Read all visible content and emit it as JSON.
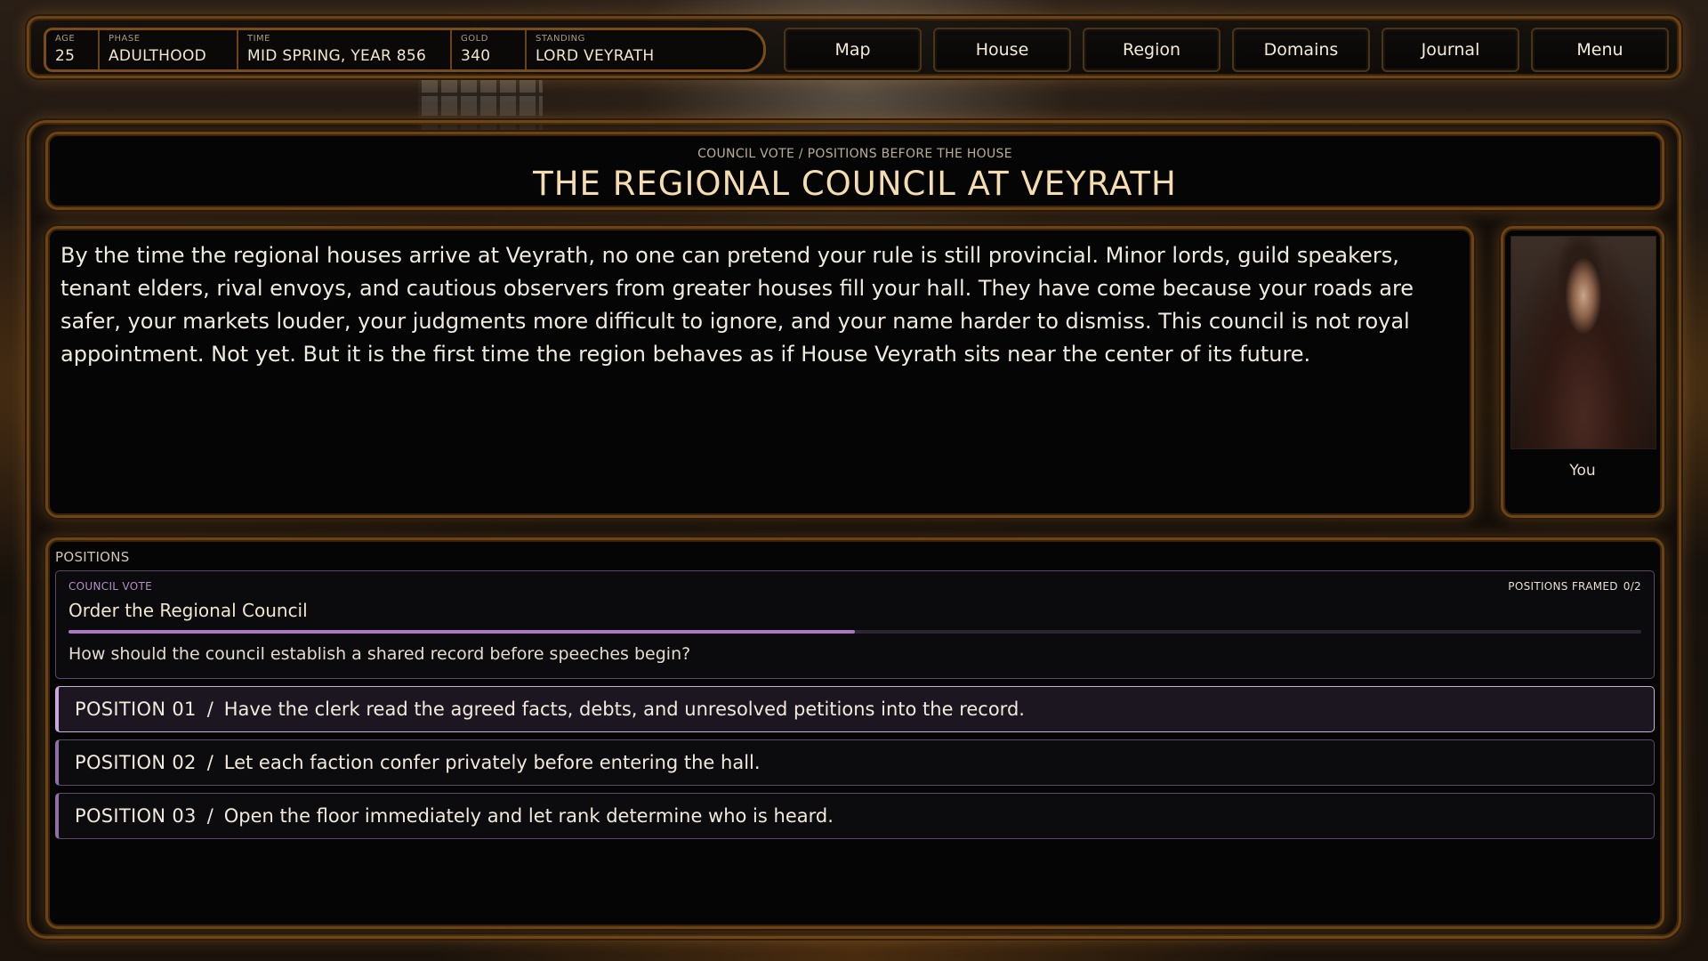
{
  "hud": {
    "stats": [
      {
        "key": "AGE",
        "value": "25"
      },
      {
        "key": "PHASE",
        "value": "ADULTHOOD"
      },
      {
        "key": "TIME",
        "value": "MID SPRING, YEAR 856"
      },
      {
        "key": "GOLD",
        "value": "340"
      },
      {
        "key": "STANDING",
        "value": "LORD VEYRATH"
      }
    ],
    "nav": [
      "Map",
      "House",
      "Region",
      "Domains",
      "Journal",
      "Menu"
    ]
  },
  "scene": {
    "breadcrumb": "COUNCIL VOTE / POSITIONS BEFORE THE HOUSE",
    "title": "THE REGIONAL COUNCIL AT VEYRATH",
    "narrative": "By the time the regional houses arrive at Veyrath, no one can pretend your rule is still provincial. Minor lords, guild speakers, tenant elders, rival envoys, and cautious observers from greater houses fill your hall. They have come because your roads are safer, your markets louder, your judgments more difficult to ignore, and your name harder to dismiss. This council is not royal appointment. Not yet. But it is the first time the region behaves as if House Veyrath sits near the center of its future.",
    "portrait_label": "You"
  },
  "positions": {
    "header": "POSITIONS",
    "vote": {
      "kind": "COUNCIL VOTE",
      "framed_label": "POSITIONS FRAMED",
      "framed_value": "0/2",
      "title": "Order the Regional Council",
      "progress": 0.5,
      "question": "How should the council establish a shared record before speeches begin?"
    },
    "options": [
      {
        "num": "POSITION 01",
        "text": "Have the clerk read the agreed facts, debts, and unresolved petitions into the record.",
        "selected": true
      },
      {
        "num": "POSITION 02",
        "text": "Let each faction confer privately before entering the hall.",
        "selected": false
      },
      {
        "num": "POSITION 03",
        "text": "Open the floor immediately and let rank determine who is heard.",
        "selected": false
      }
    ]
  },
  "colors": {
    "gold_frame": "#6b4317",
    "title_gold": "#f5ddb0",
    "accent_purple": "#a978c0"
  }
}
